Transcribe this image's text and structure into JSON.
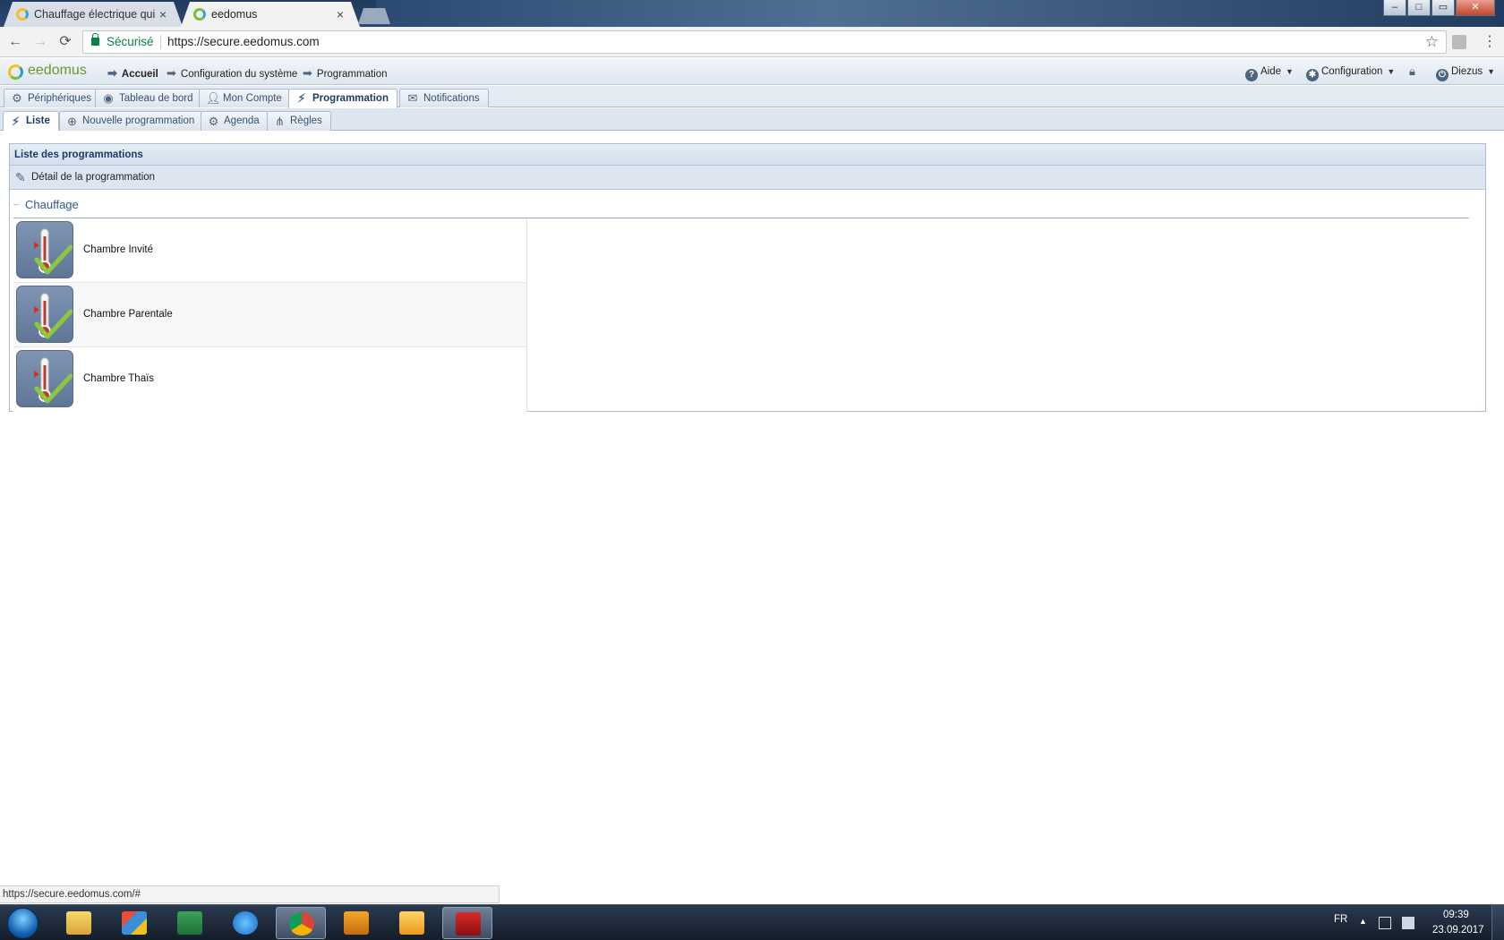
{
  "browser": {
    "tabs": [
      {
        "title": "Chauffage électrique qui",
        "active": false
      },
      {
        "title": "eedomus",
        "active": true
      }
    ],
    "tab_close_glyph": "×",
    "window_controls": [
      "–",
      "□",
      "✕"
    ],
    "nav": {
      "back": "←",
      "forward": "→",
      "reload": "⟳"
    },
    "secure_label": "Sécurisé",
    "url": "https://secure.eedomus.com",
    "star_glyph": "☆",
    "menu_glyph": "⋮",
    "status_url": "https://secure.eedomus.com/#"
  },
  "app": {
    "logo": "eedomus",
    "breadcrumb": [
      {
        "label": "Accueil",
        "bold": true
      },
      {
        "label": "Configuration du système",
        "bold": false
      },
      {
        "label": "Programmation",
        "bold": false
      }
    ],
    "header_right": {
      "help": "Aide",
      "config": "Configuration",
      "user": "Diezus"
    },
    "main_tabs": [
      {
        "label": "Périphériques",
        "icon": "gear-icon",
        "active": false
      },
      {
        "label": "Tableau de bord",
        "icon": "dashboard-icon",
        "active": false
      },
      {
        "label": "Mon Compte",
        "icon": "user-icon",
        "active": false
      },
      {
        "label": "Programmation",
        "icon": "magic-wand-icon",
        "active": true
      },
      {
        "label": "Notifications",
        "icon": "envelope-icon",
        "active": false
      }
    ],
    "sub_tabs": [
      {
        "label": "Liste",
        "icon": "magic-wand-icon",
        "active": true
      },
      {
        "label": "Nouvelle programmation",
        "icon": "plus-circle-icon",
        "active": false
      },
      {
        "label": "Agenda",
        "icon": "gear-icon",
        "active": false
      },
      {
        "label": "Règles",
        "icon": "hierarchy-icon",
        "active": false
      }
    ],
    "panel": {
      "title": "Liste des programmations",
      "toolbar_label": "Détail de la programmation",
      "group": {
        "title": "Chauffage",
        "collapse_glyph": "–",
        "items": [
          {
            "name": "Chambre Invité"
          },
          {
            "name": "Chambre Parentale"
          },
          {
            "name": "Chambre Thaïs"
          }
        ]
      }
    }
  },
  "taskbar": {
    "apps": [
      "file-explorer-icon",
      "paint-icon",
      "excel-icon",
      "internet-explorer-icon",
      "chrome-icon",
      "media-player-icon",
      "outlook-icon",
      "acrobat-icon"
    ],
    "language": "FR",
    "time": "09:39",
    "date": "23.09.2017",
    "tray_arrow": "▲"
  }
}
